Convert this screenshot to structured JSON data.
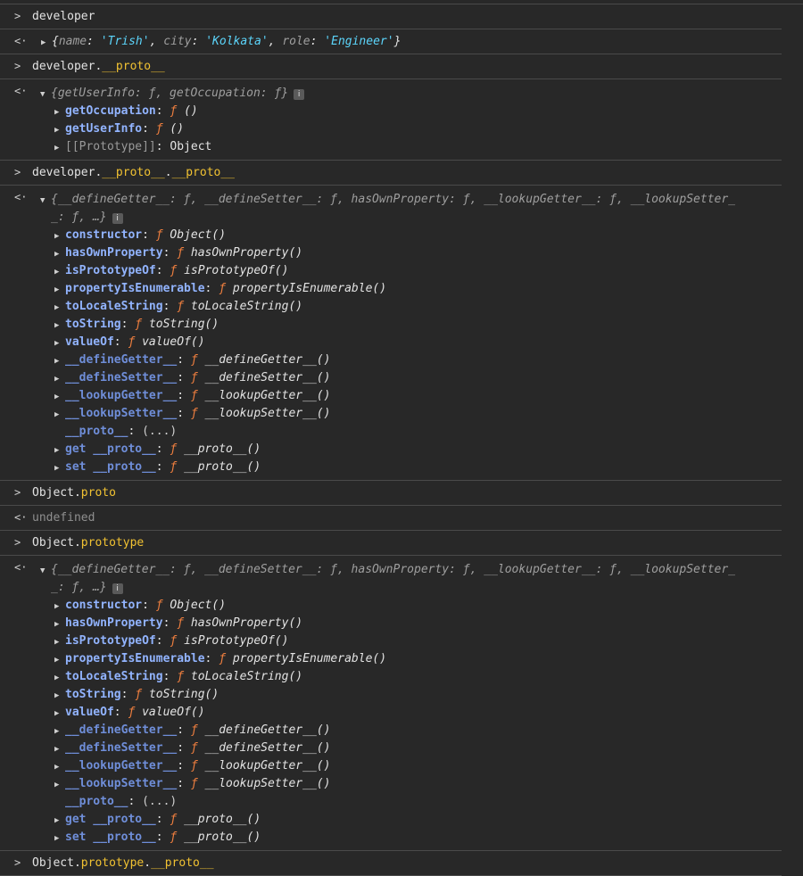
{
  "prompt_symbol": ">",
  "result_symbol": "<·",
  "entries": {
    "c1": "developer",
    "o1": {
      "name_key": "name",
      "name_val": "'Trish'",
      "city_key": "city",
      "city_val": "'Kolkata'",
      "role_key": "role",
      "role_val": "'Engineer'"
    },
    "c2_a": "developer.",
    "c2_b": "__proto__",
    "o2": {
      "summary": "{getUserInfo: ƒ, getOccupation: ƒ}",
      "rows": [
        {
          "key": "getOccupation",
          "val": "()"
        },
        {
          "key": "getUserInfo",
          "val": "()"
        }
      ],
      "proto_key": "[[Prototype]]",
      "proto_val": "Object"
    },
    "c3_a": "developer.",
    "c3_b": "__proto__",
    "c3_c": ".",
    "c3_d": "__proto__",
    "summary_obj": "{__defineGetter__: ƒ, __defineSetter__: ƒ, hasOwnProperty: ƒ, __lookupGetter__: ƒ, __lookupSetter_",
    "summary_obj2": "_: ƒ, …}",
    "obj_rows": [
      {
        "key": "constructor",
        "val": "Object()"
      },
      {
        "key": "hasOwnProperty",
        "val": "hasOwnProperty()"
      },
      {
        "key": "isPrototypeOf",
        "val": "isPrototypeOf()"
      },
      {
        "key": "propertyIsEnumerable",
        "val": "propertyIsEnumerable()"
      },
      {
        "key": "toLocaleString",
        "val": "toLocaleString()"
      },
      {
        "key": "toString",
        "val": "toString()"
      },
      {
        "key": "valueOf",
        "val": "valueOf()"
      },
      {
        "key": "__defineGetter__",
        "val": "__defineGetter__()"
      },
      {
        "key": "__defineSetter__",
        "val": "__defineSetter__()"
      },
      {
        "key": "__lookupGetter__",
        "val": "__lookupGetter__()"
      },
      {
        "key": "__lookupSetter__",
        "val": "__lookupSetter__()"
      }
    ],
    "proto_row": {
      "key": "__proto__",
      "val": "(...)"
    },
    "get_row": {
      "key": "get __proto__",
      "val": "__proto__()"
    },
    "set_row": {
      "key": "set __proto__",
      "val": "__proto__()"
    },
    "c4_a": "Object.",
    "c4_b": "proto",
    "o4": "undefined",
    "c5_a": "Object.",
    "c5_b": "prototype",
    "c6_a": "Object.",
    "c6_b": "prototype",
    "c6_c": ".",
    "c6_d": "__proto__"
  },
  "icons": {
    "chevron": "▶",
    "expanded": "▼",
    "info": "i",
    "f": "ƒ"
  }
}
